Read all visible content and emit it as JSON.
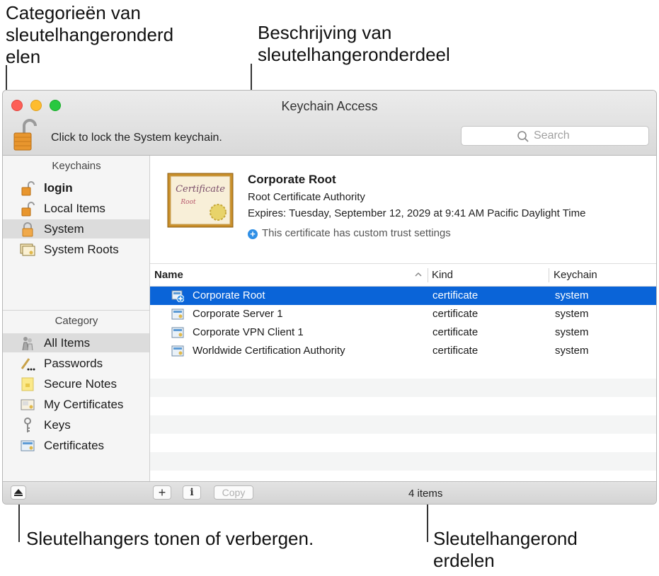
{
  "callouts": {
    "categories": [
      "Categorieën van",
      "sleutelhangeronderd",
      "elen"
    ],
    "description": [
      "Beschrijving van",
      "sleutelhangeronderdeel"
    ],
    "toggle": "Sleutelhangers tonen of verbergen.",
    "items": [
      "Sleutelhangerond",
      "erdelen"
    ]
  },
  "window": {
    "title": "Keychain Access"
  },
  "toolbar": {
    "lock_text": "Click to lock the System keychain.",
    "search_placeholder": "Search"
  },
  "sidebar": {
    "keychains_header": "Keychains",
    "keychains": [
      {
        "label": "login",
        "icon": "unlocked-padlock-icon"
      },
      {
        "label": "Local Items",
        "icon": "unlocked-padlock-icon"
      },
      {
        "label": "System",
        "icon": "padlock-icon"
      },
      {
        "label": "System Roots",
        "icon": "certificate-folder-icon"
      }
    ],
    "category_header": "Category",
    "categories": [
      {
        "label": "All Items",
        "icon": "people-keys-icon"
      },
      {
        "label": "Passwords",
        "icon": "pen-dots-icon"
      },
      {
        "label": "Secure Notes",
        "icon": "note-icon"
      },
      {
        "label": "My Certificates",
        "icon": "certificate-person-icon"
      },
      {
        "label": "Keys",
        "icon": "key-icon"
      },
      {
        "label": "Certificates",
        "icon": "certificate-icon"
      }
    ]
  },
  "detail": {
    "name": "Corporate Root",
    "type": "Root Certificate Authority",
    "expires": "Expires: Tuesday, September 12, 2029 at 9:41 AM Pacific Daylight Time",
    "trust": "This certificate has custom trust settings",
    "certificate_script": "Certificate",
    "certificate_sub": "Root"
  },
  "table": {
    "columns": {
      "name": "Name",
      "kind": "Kind",
      "keychain": "Keychain"
    },
    "rows": [
      {
        "name": "Corporate Root",
        "kind": "certificate",
        "keychain": "system"
      },
      {
        "name": "Corporate Server 1",
        "kind": "certificate",
        "keychain": "system"
      },
      {
        "name": "Corporate VPN Client 1",
        "kind": "certificate",
        "keychain": "system"
      },
      {
        "name": "Worldwide Certification Authority",
        "kind": "certificate",
        "keychain": "system"
      }
    ]
  },
  "bottom": {
    "add_label": "+",
    "info_label": "i",
    "copy_label": "Copy",
    "count": "4 items"
  },
  "colors": {
    "selection": "#0a64d8",
    "trust_icon": "#2f8fe6"
  }
}
